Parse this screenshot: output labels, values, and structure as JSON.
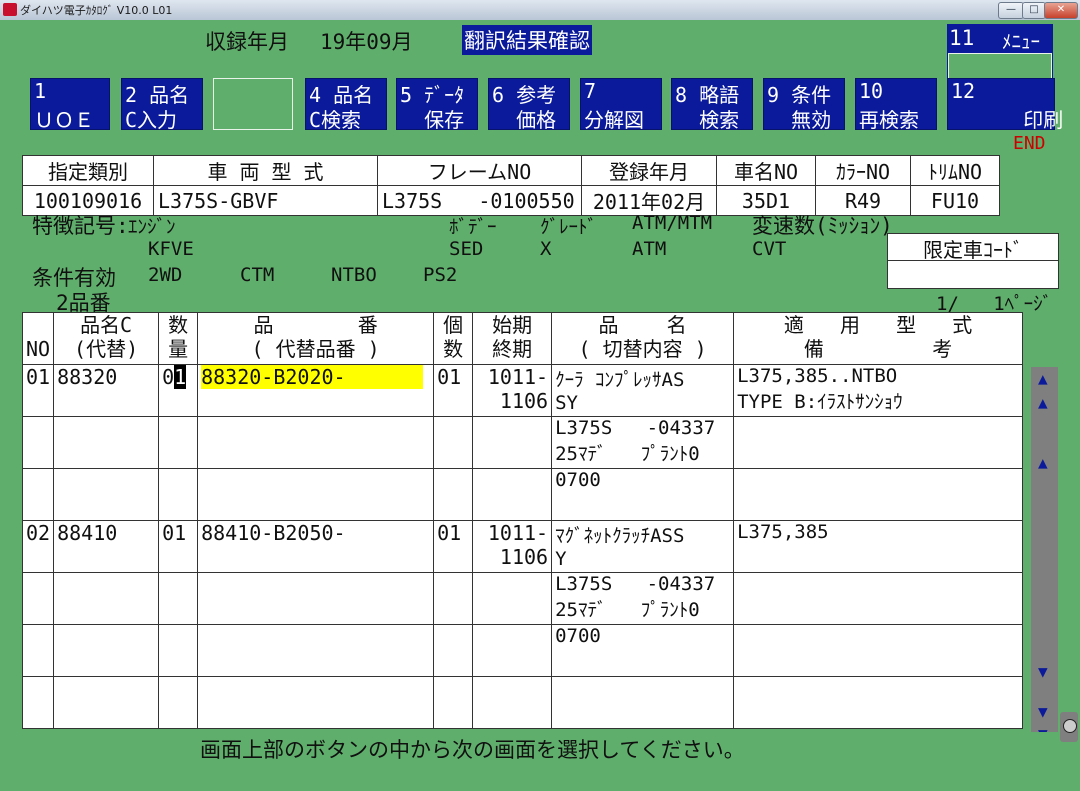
{
  "window": {
    "title": "ダイハツ電子ｶﾀﾛｸﾞ V10.0 L01",
    "min_label": "—",
    "max_label": "□",
    "close_label": "✕"
  },
  "header": {
    "record_label": "収録年月",
    "record_value": "19年09月",
    "screen_title": "翻訳結果確認"
  },
  "menu_box": {
    "num": "11",
    "label": "ﾒﾆｭｰ"
  },
  "fkeys": [
    {
      "l1": "1",
      "l2": "ＵＯＥ"
    },
    {
      "l1": "2 品名",
      "l2": "C入力"
    },
    {
      "l1": "",
      "l2": ""
    },
    {
      "l1": "4 品名",
      "l2": "C検索"
    },
    {
      "l1": "5 ﾃﾞｰﾀ",
      "l2": "  保存"
    },
    {
      "l1": "6 参考",
      "l2": "  価格"
    },
    {
      "l1": "7",
      "l2": "分解図"
    },
    {
      "l1": "8 略語",
      "l2": "  検索"
    },
    {
      "l1": "9 条件",
      "l2": "  無効"
    },
    {
      "l1": "10",
      "l2": "再検索"
    },
    {
      "l1": "12",
      "l2": "      印刷"
    }
  ],
  "end_label": "END",
  "info": {
    "headers": [
      "指定類別",
      "車 両 型 式",
      "フレームNO",
      "登録年月",
      "車名NO",
      "ｶﾗｰNO",
      "ﾄﾘﾑNO"
    ],
    "values": [
      "100109016",
      "L375S-GBVF",
      "L375S   -0100550",
      "2011年02月",
      "35D1",
      "R49",
      "FU10"
    ]
  },
  "features": {
    "label": "特徴記号:",
    "engine_label": "ｴﾝｼﾞﾝ",
    "engine_value": "KFVE",
    "body_label": "ﾎﾞﾃﾞｰ",
    "body_value": "SED",
    "grade_label": "ｸﾞﾚｰﾄﾞ",
    "grade_value": "X",
    "atm_label": "ATM/MTM",
    "atm_value": "ATM",
    "trans_label": "変速数(ﾐｯｼｮﾝ)",
    "trans_value": "CVT",
    "cond_label": "条件有効",
    "cond_values": [
      "2WD",
      "CTM",
      "NTBO",
      "PS2"
    ],
    "limited_label": "限定車ｺｰﾄﾞ",
    "count_label": "2品番",
    "page": "1/   1ﾍﾟｰｼﾞ"
  },
  "grid": {
    "headers": {
      "no": "NO",
      "code_top": "品名C",
      "code_bot": "(代替)",
      "qty_top": "数",
      "qty_bot": "量",
      "part_top": "品       番",
      "part_bot": "( 代替品番 )",
      "pcs_top": "個",
      "pcs_bot": "数",
      "period_top": "始期",
      "period_bot": "終期",
      "name_top": "品    名",
      "name_bot": "( 切替内容 )",
      "apply_top": "適   用   型   式",
      "apply_bot": "備         考"
    },
    "rows": [
      {
        "no": "01",
        "code": "88320",
        "qty_a": "0",
        "qty_b": "1",
        "part": "88320-B2020-",
        "pcs": "01",
        "start": "1011-",
        "end": "1106",
        "name1": "ｸｰﾗ ｺﾝﾌﾟﾚｯｻAS",
        "name2": "SY",
        "apply1": "L375,385..NTBO",
        "apply2": "TYPE B:ｲﾗｽﾄｻﾝｼｮｳ",
        "sub1": "L375S   -04337",
        "sub2": "25ﾏﾃﾞ   ﾌﾟﾗﾝﾄ0",
        "sub3": "0700"
      },
      {
        "no": "02",
        "code": "88410",
        "qty": "01",
        "part": "88410-B2050-",
        "pcs": "01",
        "start": "1011-",
        "end": "1106",
        "name1": "ﾏｸﾞﾈｯﾄｸﾗｯﾁASS",
        "name2": "Y",
        "apply1": "L375,385",
        "apply2": "",
        "sub1": "L375S   -04337",
        "sub2": "25ﾏﾃﾞ   ﾌﾟﾗﾝﾄ0",
        "sub3": "0700"
      }
    ]
  },
  "message": "画面上部のボタンの中から次の画面を選択してください。"
}
